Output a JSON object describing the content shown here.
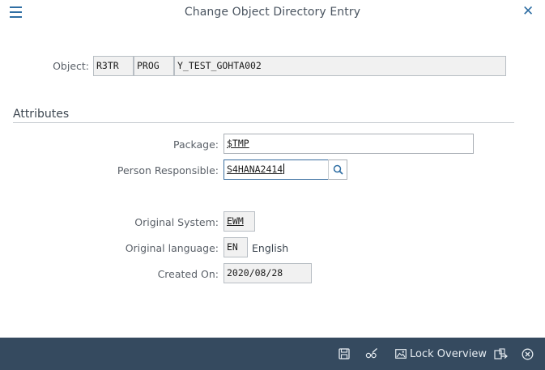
{
  "header": {
    "title": "Change Object Directory Entry"
  },
  "object": {
    "label": "Object:",
    "pgmid": "R3TR",
    "type": "PROG",
    "name": "Y_TEST_GOHTA002"
  },
  "attributes": {
    "section_title": "Attributes",
    "package": {
      "label": "Package:",
      "value": "$TMP"
    },
    "person": {
      "label": "Person Responsible:",
      "value": "S4HANA2414"
    },
    "original_system": {
      "label": "Original System:",
      "value": "EWM"
    },
    "original_language": {
      "label": "Original language:",
      "code": "EN",
      "name": "English"
    },
    "created_on": {
      "label": "Created On:",
      "value": "2020/08/28"
    }
  },
  "footer": {
    "lock_overview_label": "Lock Overview"
  },
  "colors": {
    "accent": "#2f6ea3",
    "footer_bg": "#354a5f",
    "readonly_bg": "#f1f1f1"
  }
}
